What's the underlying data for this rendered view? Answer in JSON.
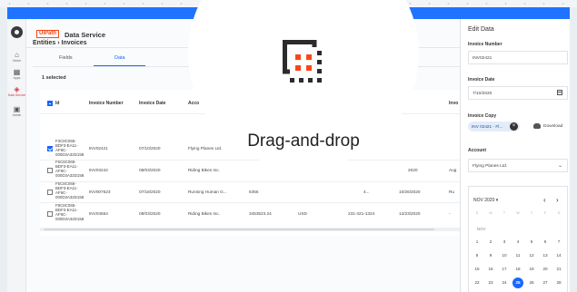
{
  "sidebar": {
    "items": [
      {
        "label": "Home",
        "icon": "home-icon"
      },
      {
        "label": "Apps",
        "icon": "apps-icon"
      },
      {
        "label": "Data Service",
        "icon": "data-service-icon"
      },
      {
        "label": "Admin",
        "icon": "admin-icon"
      }
    ]
  },
  "header": {
    "brand": "UiPath",
    "title": "Data Service"
  },
  "breadcrumb": "Entities › Invoices",
  "tabs": [
    {
      "label": "Fields"
    },
    {
      "label": "Data"
    }
  ],
  "selection": {
    "text": "1 selected"
  },
  "table": {
    "columns": [
      "Id",
      "Invoice Number",
      "Invoice Date",
      "Acco",
      "Invo"
    ],
    "rows": [
      {
        "id": "F3C8C065-\nBDF3-EA11-\nAF9C-\n000D3A32D158",
        "number": "INV02421",
        "date": "07/10/2020",
        "account": "Flying Planes Ltd.",
        "checked": true
      },
      {
        "id": "F6C8C065-\nBDF3-EA11-\nAF9C-\n000D3A32D158",
        "number": "INV03242",
        "date": "08/03/2020",
        "account": "Riding Bikes Inc.",
        "amount": "",
        "currency": "",
        "phone": "",
        "due": "2020",
        "tail": "Aug",
        "checked": false
      },
      {
        "id": "F5C8C065-\nBDF3-EA11-\nAF9C-\n000D3A32D158",
        "number": "INV007623",
        "date": "07/18/2020",
        "account": "Running Human G...",
        "amount": "6356",
        "currency": "",
        "phone": "4...",
        "due": "10/26/2020",
        "tail": "Ru",
        "checked": false
      },
      {
        "id": "F8C8C065-\nBDF3-EA11-\nAF9C-\n000D3A32D158",
        "number": "INV04564",
        "date": "08/03/2020",
        "account": "Riding Bikes Inc.",
        "amount": "3453523.24",
        "currency": "USD",
        "phone": "231-321-1324",
        "due": "12/23/2020",
        "tail": "-",
        "checked": false
      }
    ]
  },
  "drawer": {
    "title": "Edit Data",
    "invoice_number_label": "Invoice Number",
    "invoice_number_value": "INV02421",
    "invoice_date_label": "Invoice Date",
    "invoice_date_value": "7/10/2020",
    "invoice_copy_label": "Invoice Copy",
    "invoice_copy_chip": "INV 02421 - Fl...",
    "download_label": "Download",
    "account_label": "Account",
    "account_value": "Flying Planes Ltd."
  },
  "calendar": {
    "month_label": "NOV 2020",
    "weekdays": [
      "S",
      "M",
      "T",
      "W",
      "T",
      "F",
      "S"
    ],
    "section_label": "NOV",
    "weeks": [
      [
        "1",
        "2",
        "3",
        "4",
        "5",
        "6",
        "7"
      ],
      [
        "8",
        "9",
        "10",
        "11",
        "12",
        "13",
        "14"
      ],
      [
        "15",
        "16",
        "17",
        "18",
        "19",
        "20",
        "21"
      ],
      [
        "22",
        "23",
        "24",
        "25",
        "26",
        "27",
        "28"
      ]
    ],
    "selected_day": "25"
  },
  "overlay": {
    "label": "Drag-and-drop",
    "icon": "drag-and-drop-icon",
    "accent": "#fa4616"
  }
}
